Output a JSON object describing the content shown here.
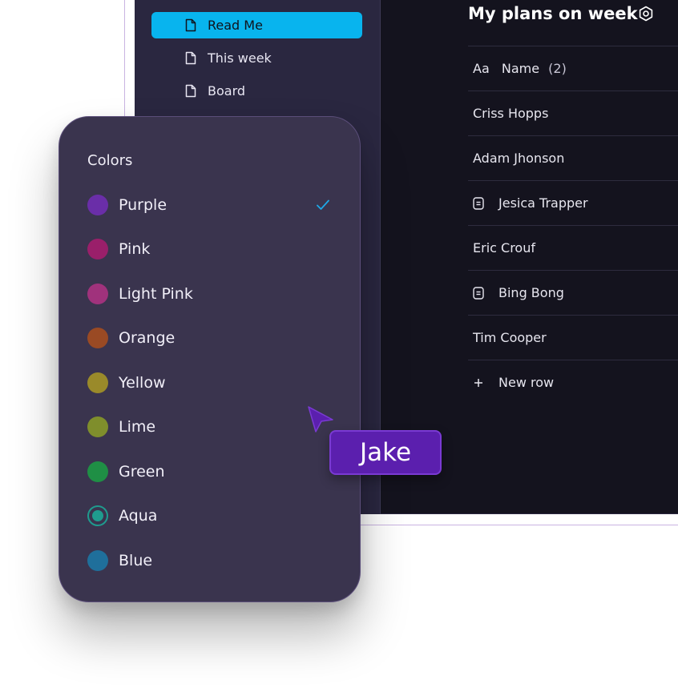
{
  "sidebar": {
    "items": [
      {
        "label": "Read Me",
        "icon": "document-icon",
        "active": true
      },
      {
        "label": "This week",
        "icon": "document-icon",
        "active": false
      },
      {
        "label": "Board",
        "icon": "document-icon",
        "active": false
      }
    ]
  },
  "main": {
    "title": "My plans on week",
    "title_icon": "settings-hexagon-icon",
    "table": {
      "header": {
        "type_glyph": "Aa",
        "label": "Name",
        "count": "(2)"
      },
      "rows": [
        {
          "name": "Criss Hopps",
          "has_page_icon": false
        },
        {
          "name": "Adam Jhonson",
          "has_page_icon": false
        },
        {
          "name": "Jesica Trapper",
          "has_page_icon": true
        },
        {
          "name": "Eric Crouf",
          "has_page_icon": false
        },
        {
          "name": "Bing Bong",
          "has_page_icon": true
        },
        {
          "name": "Tim Cooper",
          "has_page_icon": false
        }
      ],
      "new_row_label": "New row"
    }
  },
  "colors_menu": {
    "title": "Colors",
    "selected": "Purple",
    "items": [
      {
        "label": "Purple",
        "color": "#6a2ea8",
        "selected": true
      },
      {
        "label": "Pink",
        "color": "#9a1f6a",
        "selected": false
      },
      {
        "label": "Light Pink",
        "color": "#a0327c",
        "selected": false
      },
      {
        "label": "Orange",
        "color": "#9a4a24",
        "selected": false
      },
      {
        "label": "Yellow",
        "color": "#9a8a2a",
        "selected": false
      },
      {
        "label": "Lime",
        "color": "#7f8e2c",
        "selected": false
      },
      {
        "label": "Green",
        "color": "#1f8f45",
        "selected": false
      },
      {
        "label": "Aqua",
        "color": "#1f9b8e",
        "selected": false,
        "focused": true
      },
      {
        "label": "Blue",
        "color": "#1f6f9b",
        "selected": false
      }
    ]
  },
  "collaborator": {
    "name": "Jake",
    "color": "#5b1fae"
  },
  "colors": {
    "accent": "#08b4ee",
    "sidebar_bg": "#2a2740",
    "main_bg": "#14131e",
    "panel_bg": "#3a344e"
  }
}
